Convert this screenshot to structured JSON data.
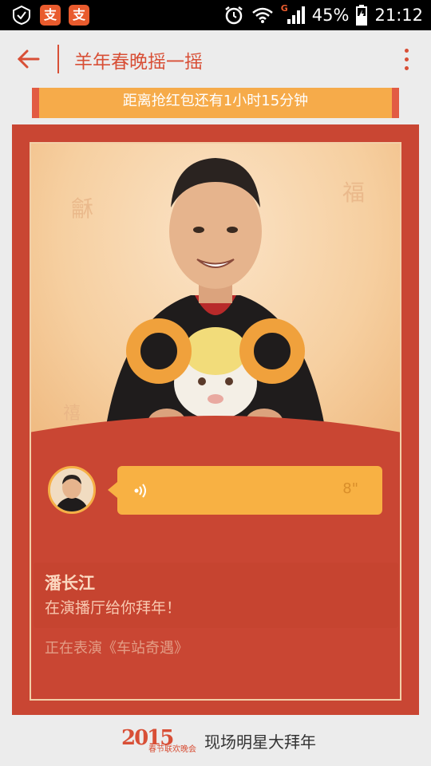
{
  "statusbar": {
    "apps": [
      "支",
      "支"
    ],
    "network_label": "G",
    "battery": "45%",
    "time": "21:12"
  },
  "appbar": {
    "title": "羊年春晚摇一摇"
  },
  "countdown": {
    "text": "距离抢红包还有1小时15分钟"
  },
  "card": {
    "voice_duration": "8\"",
    "performer_name": "潘长江",
    "greeting": "在演播厅给你拜年！",
    "performing": "正在表演《车站奇遇》"
  },
  "footer": {
    "logo_year": "2015",
    "logo_subtitle": "春节联欢晚会",
    "text": "现场明星大拜年"
  },
  "colors": {
    "accent": "#d84f36",
    "banner": "#f6ab4a",
    "card_red": "#c94633",
    "bubble": "#f8b143"
  }
}
